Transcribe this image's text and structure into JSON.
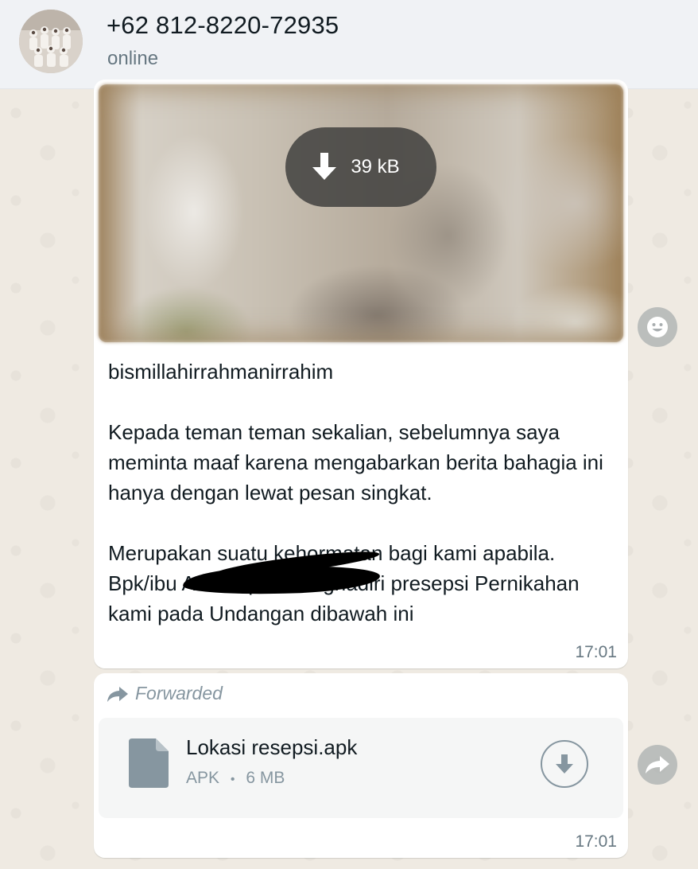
{
  "header": {
    "contact_name": "+62 812-8220-72935",
    "status": "online",
    "avatar_icon": "group-photo-avatar"
  },
  "messages": [
    {
      "type": "image",
      "download_size": "39 kB",
      "download_icon": "download-arrow-icon",
      "caption": "bismillahirrahmanirrahim\n\nKepada teman teman sekalian, sebelumnya saya meminta maaf karena mengabarkan berita bahagia ini hanya dengan lewat pesan singkat.\n\nMerupakan suatu kehormatan bagi kami apabila. Bpk/ibu A                               O Dapat menghadiri presepsi Pernikahan kami pada Undangan dibawah ini",
      "time": "17:01"
    },
    {
      "type": "document",
      "forwarded_label": "Forwarded",
      "file_name": "Lokasi resepsi.apk",
      "file_type": "APK",
      "file_size": "6 MB",
      "meta_separator": "•",
      "time": "17:01"
    }
  ],
  "side_actions": {
    "react_icon": "emoji-icon",
    "forward_icon": "forward-arrow-icon"
  },
  "colors": {
    "header_bg": "#f0f2f5",
    "chat_bg": "#efeae2",
    "bubble_bg": "#ffffff",
    "text_primary": "#111b21",
    "text_secondary": "#667781"
  }
}
